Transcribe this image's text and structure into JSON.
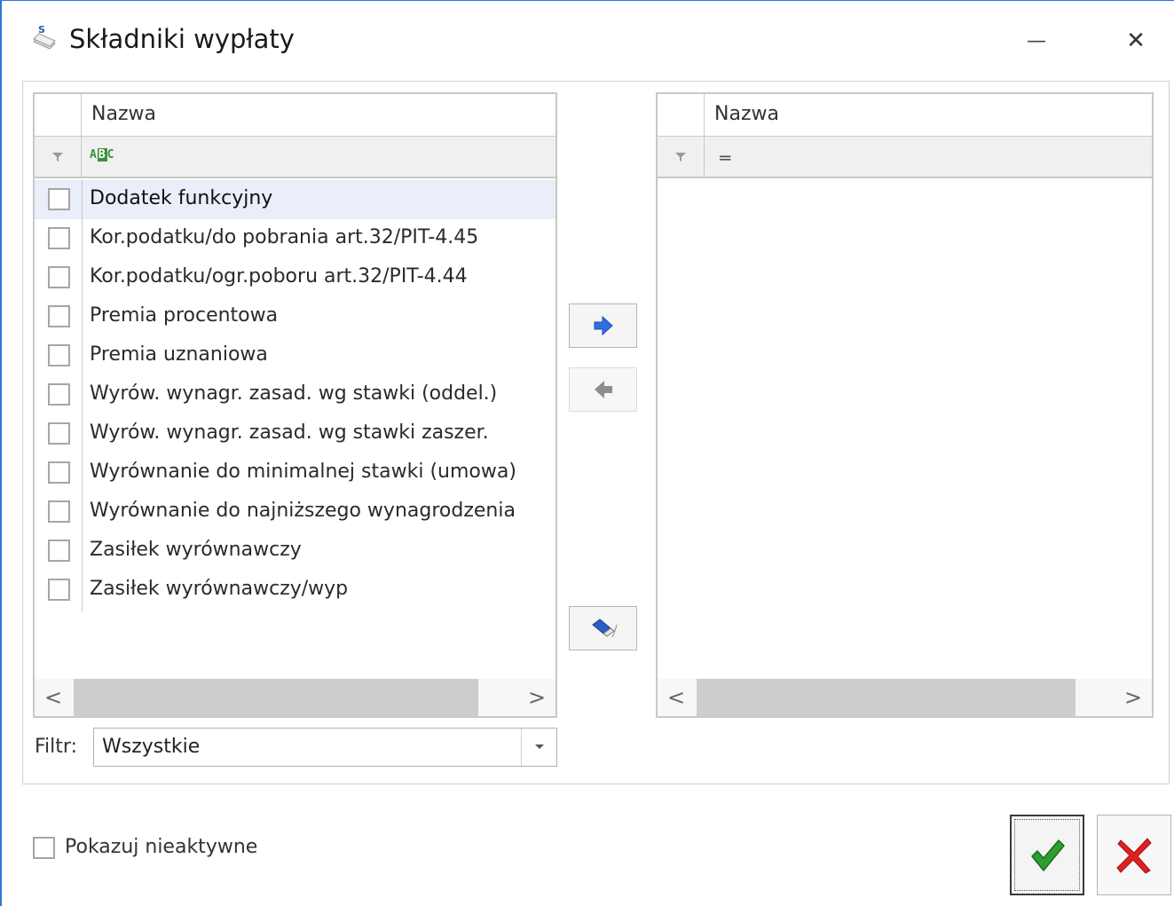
{
  "window": {
    "title": "Składniki wypłaty",
    "minimize_glyph": "—",
    "close_glyph": "✕",
    "accent_color": "#2b79d6"
  },
  "left_grid": {
    "column_header": "Nazwa",
    "filter_row_icon": "abc-text-filter-icon",
    "items": [
      {
        "label": "Dodatek funkcyjny",
        "checked": false,
        "selected": true
      },
      {
        "label": "Kor.podatku/do pobrania art.32/PIT-4.45",
        "checked": false,
        "selected": false
      },
      {
        "label": "Kor.podatku/ogr.poboru art.32/PIT-4.44",
        "checked": false,
        "selected": false
      },
      {
        "label": "Premia procentowa",
        "checked": false,
        "selected": false
      },
      {
        "label": "Premia uznaniowa",
        "checked": false,
        "selected": false
      },
      {
        "label": "Wyrów. wynagr. zasad. wg stawki (oddel.)",
        "checked": false,
        "selected": false
      },
      {
        "label": "Wyrów. wynagr. zasad. wg stawki zaszer.",
        "checked": false,
        "selected": false
      },
      {
        "label": "Wyrównanie do minimalnej stawki (umowa)",
        "checked": false,
        "selected": false
      },
      {
        "label": "Wyrównanie do najniższego wynagrodzenia",
        "checked": false,
        "selected": false
      },
      {
        "label": "Zasiłek wyrównawczy",
        "checked": false,
        "selected": false
      },
      {
        "label": "Zasiłek wyrównawczy/wyp",
        "checked": false,
        "selected": false
      }
    ],
    "scroll_left": "<",
    "scroll_right": ">"
  },
  "right_grid": {
    "column_header": "Nazwa",
    "filter_row_icon": "equals-filter-icon",
    "filter_glyph": "═",
    "items": [],
    "scroll_left": "<",
    "scroll_right": ">"
  },
  "transfer_buttons": {
    "add_icon": "arrow-right-icon",
    "remove_icon": "arrow-left-icon",
    "clear_icon": "eraser-icon"
  },
  "filter": {
    "label": "Filtr:",
    "value": "Wszystkie"
  },
  "show_inactive": {
    "label": "Pokazuj nieaktywne",
    "checked": false
  },
  "actions": {
    "ok_icon": "checkmark-icon",
    "cancel_icon": "red-x-icon",
    "ok_color": "#2e9e2e",
    "cancel_color": "#e02020"
  }
}
